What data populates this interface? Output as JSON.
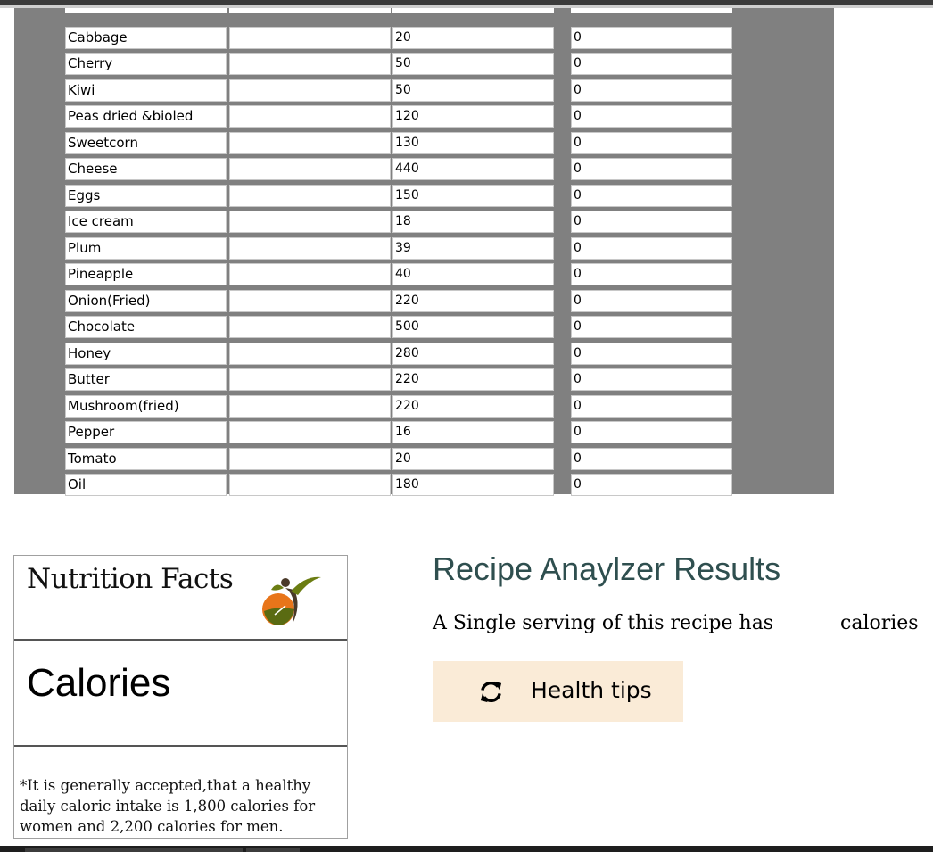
{
  "table": {
    "rows": [
      {
        "name": "Cabbage",
        "blank": "",
        "value": "20",
        "zero": "0"
      },
      {
        "name": "Cherry",
        "blank": "",
        "value": "50",
        "zero": "0"
      },
      {
        "name": "Kiwi",
        "blank": "",
        "value": "50",
        "zero": "0"
      },
      {
        "name": "Peas dried &bioled",
        "blank": "",
        "value": "120",
        "zero": "0"
      },
      {
        "name": "Sweetcorn",
        "blank": "",
        "value": "130",
        "zero": "0"
      },
      {
        "name": "Cheese",
        "blank": "",
        "value": "440",
        "zero": "0"
      },
      {
        "name": "Eggs",
        "blank": "",
        "value": "150",
        "zero": "0"
      },
      {
        "name": "Ice cream",
        "blank": "",
        "value": "18",
        "zero": "0"
      },
      {
        "name": "Plum",
        "blank": "",
        "value": "39",
        "zero": "0"
      },
      {
        "name": "Pineapple",
        "blank": "",
        "value": "40",
        "zero": "0"
      },
      {
        "name": "Onion(Fried)",
        "blank": "",
        "value": "220",
        "zero": "0"
      },
      {
        "name": "Chocolate",
        "blank": "",
        "value": "500",
        "zero": "0"
      },
      {
        "name": "Honey",
        "blank": "",
        "value": "280",
        "zero": "0"
      },
      {
        "name": "Butter",
        "blank": "",
        "value": "220",
        "zero": "0"
      },
      {
        "name": "Mushroom(fried)",
        "blank": "",
        "value": "220",
        "zero": "0"
      },
      {
        "name": "Pepper",
        "blank": "",
        "value": "16",
        "zero": "0"
      },
      {
        "name": "Tomato",
        "blank": "",
        "value": "20",
        "zero": "0"
      },
      {
        "name": "Oil",
        "blank": "",
        "value": "180",
        "zero": "0"
      }
    ]
  },
  "nutrition": {
    "title": "Nutrition Facts",
    "logo_icon": "fruit-person-logo-icon",
    "calories_label": "Calories",
    "note": "*It is generally accepted,that a healthy daily caloric intake is 1,800 calories for women and 2,200 calories for men."
  },
  "results": {
    "title": "Recipe Anaylzer Results",
    "serving_text": "A Single serving of this recipe has",
    "calories_value": "",
    "calories_unit": "calories",
    "button_icon": "refresh-icon",
    "button_label": "Health tips"
  },
  "colors": {
    "panel_gray": "#808080",
    "title_color": "#2f4f4f",
    "button_bg": "#faebd7"
  }
}
